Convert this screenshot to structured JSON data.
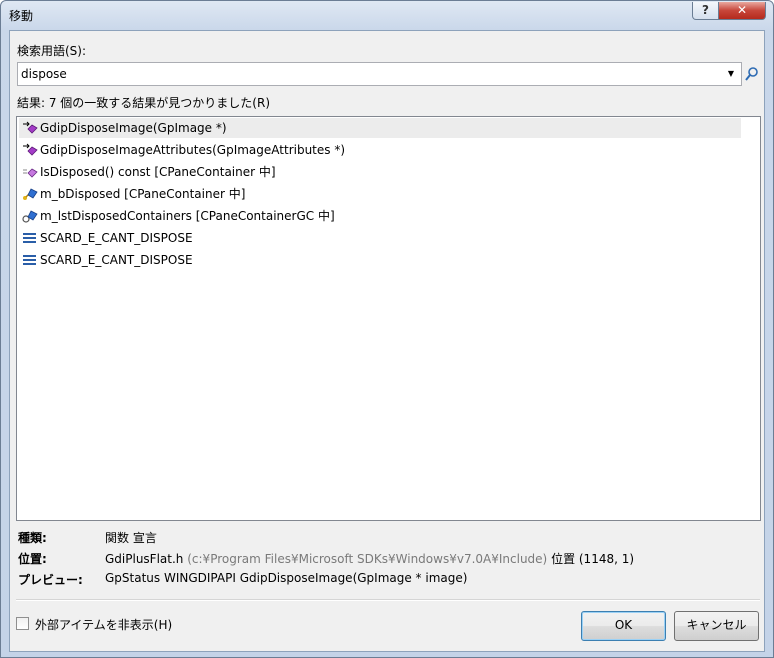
{
  "window": {
    "title": "移動",
    "help_label": "?",
    "close_label": "✕"
  },
  "search": {
    "label": "検索用語(S):",
    "value": "dispose"
  },
  "results": {
    "summary": "結果: 7 個の一致する結果が見つかりました(R)",
    "items": [
      {
        "icon": "public-function-icon",
        "label": "GdipDisposeImage(GpImage *)"
      },
      {
        "icon": "public-function-icon",
        "label": "GdipDisposeImageAttributes(GpImageAttributes *)"
      },
      {
        "icon": "private-function-icon",
        "label": "IsDisposed() const [CPaneContainer 中]"
      },
      {
        "icon": "protected-field-icon",
        "label": "m_bDisposed [CPaneContainer 中]"
      },
      {
        "icon": "protected-field-icon",
        "label": "m_lstDisposedContainers [CPaneContainerGC 中]"
      },
      {
        "icon": "macro-icon",
        "label": "SCARD_E_CANT_DISPOSE"
      },
      {
        "icon": "macro-icon",
        "label": "SCARD_E_CANT_DISPOSE"
      }
    ]
  },
  "details": {
    "kind_label": "種類:",
    "kind_value": "関数 宣言",
    "location_label": "位置:",
    "location_file": "GdiPlusFlat.h",
    "location_path": "(c:¥Program Files¥Microsoft SDKs¥Windows¥v7.0A¥Include)",
    "location_pos": "位置 (1148, 1)",
    "preview_label": "プレビュー:",
    "preview_value": "GpStatus WINGDIPAPI GdipDisposeImage(GpImage * image)"
  },
  "footer": {
    "hide_external_label": "外部アイテムを非表示(H)",
    "hide_external_checked": false,
    "ok_label": "OK",
    "cancel_label": "キャンセル"
  }
}
